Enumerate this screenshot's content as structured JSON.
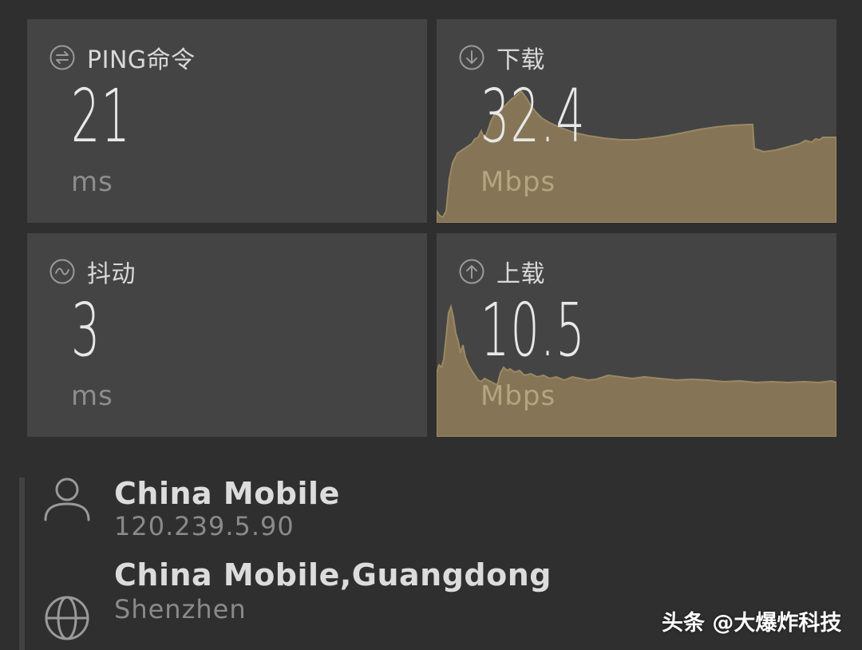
{
  "colors": {
    "background": "#2f2f2f",
    "tile": "#444444",
    "graph_fill": "#857556",
    "graph_stroke": "#9b8863",
    "label": "#d9d9d9",
    "unit": "#8d8d8d"
  },
  "ping": {
    "title": "PING命令",
    "value": "21",
    "unit": "ms",
    "icon": "ping-arrows-icon"
  },
  "download": {
    "title": "下载",
    "value": "32.4",
    "unit": "Mbps",
    "icon": "download-arrow-icon"
  },
  "jitter": {
    "title": "抖动",
    "value": "3",
    "unit": "ms",
    "icon": "jitter-wave-icon"
  },
  "upload": {
    "title": "上载",
    "value": "10.5",
    "unit": "Mbps",
    "icon": "upload-arrow-icon"
  },
  "provider": {
    "name": "China Mobile",
    "ip": "120.239.5.90",
    "icon": "user-icon"
  },
  "server": {
    "name": "China Mobile,Guangdong",
    "city": "Shenzhen",
    "icon": "globe-icon"
  },
  "watermark": {
    "text": "头条 @大爆炸科技"
  }
}
